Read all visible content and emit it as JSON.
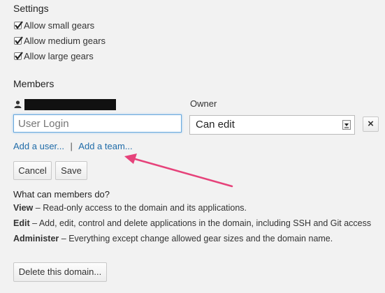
{
  "settings": {
    "title": "Settings",
    "options": [
      {
        "label": "Allow small gears",
        "checked": true
      },
      {
        "label": "Allow medium gears",
        "checked": true
      },
      {
        "label": "Allow large gears",
        "checked": true
      }
    ]
  },
  "members": {
    "title": "Members",
    "role_header": "Owner",
    "login_placeholder": "User Login",
    "permission_selected": "Can edit",
    "remove_label": "×",
    "add_user_link": "Add a user...",
    "link_separator": "|",
    "add_team_link": "Add a team..."
  },
  "actions": {
    "cancel_label": "Cancel",
    "save_label": "Save"
  },
  "help": {
    "question": "What can members do?",
    "roles": [
      {
        "name": "View",
        "dash": "–",
        "text": "Read-only access to the domain and its applications."
      },
      {
        "name": "Edit",
        "dash": "–",
        "text": "Add, edit, control and delete applications in the domain, including SSH and Git access"
      },
      {
        "name": "Administer",
        "dash": "–",
        "text": "Everything except change allowed gear sizes and the domain name."
      }
    ]
  },
  "danger": {
    "delete_label": "Delete this domain..."
  },
  "colors": {
    "background": "#f2f2f2",
    "link": "#1f6ba8",
    "annotation_arrow": "#e6427a"
  },
  "icons": {
    "member": "user-icon",
    "checkbox": "check-icon",
    "remove": "close-icon",
    "select": "dropdown-arrow-icon",
    "annotation": "arrow-annotation"
  }
}
